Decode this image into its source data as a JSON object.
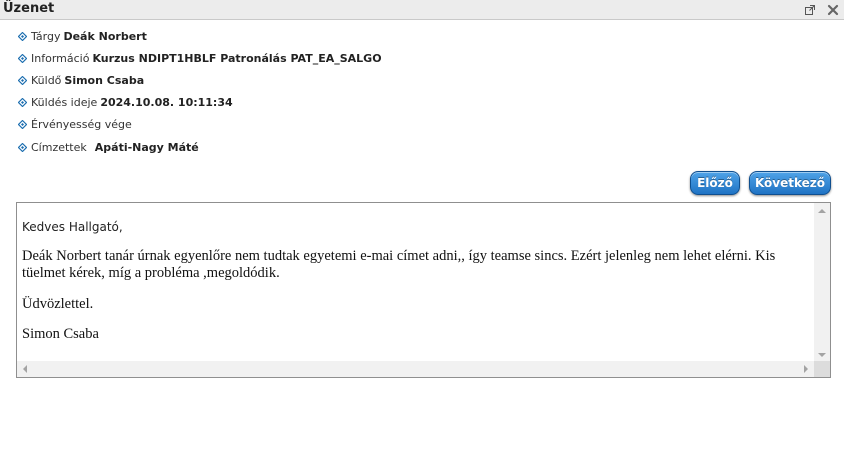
{
  "window": {
    "title": "Üzenet",
    "popout_icon": "popout-icon",
    "close_icon": "close-icon"
  },
  "details": [
    {
      "label": "Tárgy",
      "value": "Deák Norbert"
    },
    {
      "label": "Információ",
      "value": "Kurzus NDIPT1HBLF Patronálás PAT_EA_SALGO"
    },
    {
      "label": "Küldő",
      "value": "Simon Csaba"
    },
    {
      "label": "Küldés ideje",
      "value": "2024.10.08. 10:11:34"
    },
    {
      "label": "Érvényesség vége",
      "value": ""
    },
    {
      "label": "Címzettek",
      "value": "Apáti-Nagy Máté"
    }
  ],
  "nav": {
    "prev_label": "Előző",
    "next_label": "Következő"
  },
  "message": {
    "greeting": "Kedves Hallgató,",
    "body": "Deák Norbert tanár úrnak egyenlőre nem tudtak egyetemi e-mai címet adni,, így teamse sincs.  Ezért jelenleg nem lehet elérni. Kis tüelmet kérek, míg a probléma ,megoldódik.",
    "regards": "Üdvözlettel.",
    "signature": "Simon Csaba"
  },
  "colors": {
    "button_gradient_top": "#4fa3e8",
    "button_gradient_bottom": "#1f73c4",
    "bullet": "#1d6fb0",
    "titlebar": "#ececec"
  }
}
